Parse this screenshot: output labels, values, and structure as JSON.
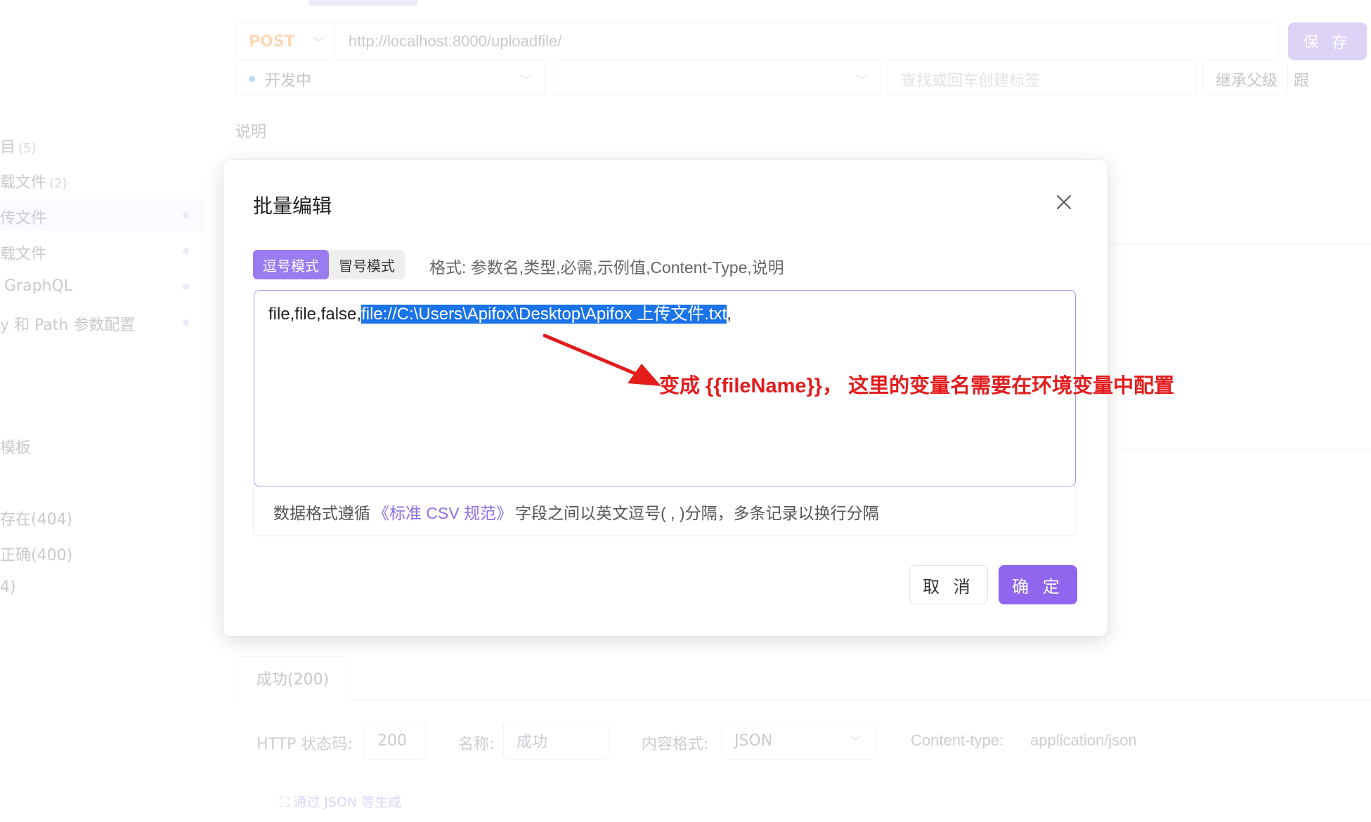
{
  "request": {
    "method": "POST",
    "url": "http://localhost:8000/uploadfile/",
    "save_label": "保 存",
    "status": "开发中",
    "tag_placeholder": "查找或回车创建标签",
    "inherit": "继承父级",
    "follow": "跟",
    "description_label": "说明"
  },
  "sidebar": {
    "items": [
      {
        "label": "目",
        "count": "(5)"
      },
      {
        "label": "载文件",
        "count": "(2)"
      },
      {
        "label": "传文件",
        "count": ""
      },
      {
        "label": "载文件",
        "count": ""
      },
      {
        "label": "GraphQL",
        "count": ""
      },
      {
        "label": "y 和 Path 参数配置",
        "count": ""
      },
      {
        "label": "模板",
        "count": ""
      },
      {
        "label": "存在(404)",
        "count": ""
      },
      {
        "label": "正确(400)",
        "count": ""
      },
      {
        "label": "4)",
        "count": ""
      }
    ]
  },
  "response": {
    "tab_label": "成功(200)",
    "status_code_label": "HTTP 状态码:",
    "status_code_value": "200",
    "name_label": "名称:",
    "name_value": "成功",
    "content_format_label": "内容格式:",
    "content_format_value": "JSON",
    "content_type_label": "Content-type:",
    "content_type_value": "application/json",
    "generate_link": "通过 JSON 等生成"
  },
  "modal": {
    "title": "批量编辑",
    "modes": [
      {
        "label": "逗号模式",
        "active": true
      },
      {
        "label": "冒号模式",
        "active": false
      }
    ],
    "format_hint": "格式: 参数名,类型,必需,示例值,Content-Type,说明",
    "editor": {
      "prefix": "file,file,false,",
      "selected": "file://C:\\Users\\Apifox\\Desktop\\Apifox 上传文件.txt",
      "suffix": ","
    },
    "csv_note_before": "数据格式遵循",
    "csv_note_link": "《标准 CSV 规范》",
    "csv_note_after": "字段之间以英文逗号( , )分隔，多条记录以换行分隔",
    "annotation": "变成 {{fileName}}， 这里的变量名需要在环境变量中配置",
    "cancel_label": "取 消",
    "ok_label": "确 定"
  },
  "colors": {
    "accent": "#9066ee",
    "annotation": "#e31c1c",
    "selection": "#1a73e8"
  }
}
